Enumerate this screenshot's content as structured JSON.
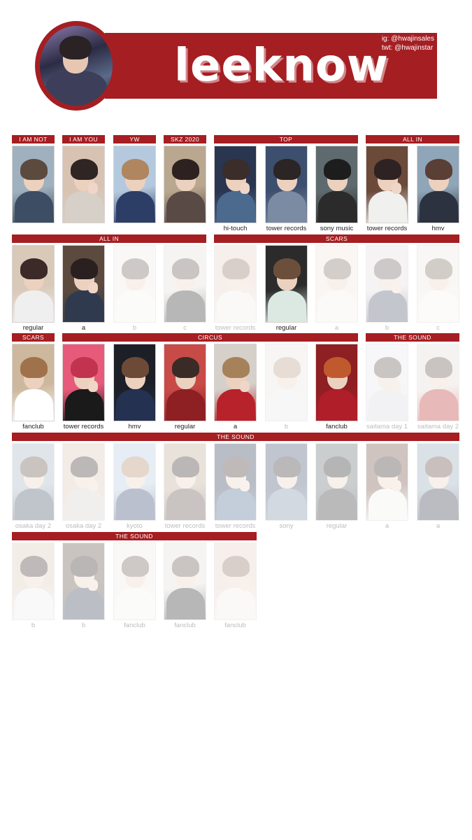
{
  "header": {
    "title": "leeknow",
    "social_ig": "ig: @hwajinsales",
    "social_twt": "twt: @hwajinstar",
    "accent_color": "#a51e22"
  },
  "sections": [
    {
      "label": "I AM NOT"
    },
    {
      "label": "I AM YOU"
    },
    {
      "label": "YW"
    },
    {
      "label": "SKZ 2020"
    },
    {
      "label": "TOP"
    },
    {
      "label": "ALL IN"
    },
    {
      "label": "ALL IN"
    },
    {
      "label": "SCARS"
    },
    {
      "label": "SCARS"
    },
    {
      "label": "CIRCUS"
    },
    {
      "label": "THE SOUND"
    },
    {
      "label": "THE SOUND"
    },
    {
      "label": "THE SOUND"
    }
  ],
  "cards": [
    {
      "caption": "",
      "owned": true
    },
    {
      "caption": "",
      "owned": true
    },
    {
      "caption": "",
      "owned": true
    },
    {
      "caption": "",
      "owned": true
    },
    {
      "caption": "hi-touch",
      "owned": true
    },
    {
      "caption": "tower records",
      "owned": true
    },
    {
      "caption": "sony music",
      "owned": true
    },
    {
      "caption": "tower records",
      "owned": true
    },
    {
      "caption": "hmv",
      "owned": true
    },
    {
      "caption": "regular",
      "owned": true
    },
    {
      "caption": "a",
      "owned": true
    },
    {
      "caption": "b",
      "owned": false
    },
    {
      "caption": "c",
      "owned": false
    },
    {
      "caption": "tower records",
      "owned": false
    },
    {
      "caption": "regular",
      "owned": true
    },
    {
      "caption": "a",
      "owned": false
    },
    {
      "caption": "b",
      "owned": false
    },
    {
      "caption": "c",
      "owned": false
    },
    {
      "caption": "fanclub",
      "owned": true
    },
    {
      "caption": "tower records",
      "owned": true
    },
    {
      "caption": "hmv",
      "owned": true
    },
    {
      "caption": "regular",
      "owned": true
    },
    {
      "caption": "a",
      "owned": true
    },
    {
      "caption": "b",
      "owned": false
    },
    {
      "caption": "fanclub",
      "owned": true
    },
    {
      "caption": "saitama day 1",
      "owned": false
    },
    {
      "caption": "saitama day 2",
      "owned": false
    },
    {
      "caption": "osaka day 2",
      "owned": false
    },
    {
      "caption": "osaka day 2",
      "owned": false
    },
    {
      "caption": "kyoto",
      "owned": false
    },
    {
      "caption": "tower records",
      "owned": false
    },
    {
      "caption": "tower records",
      "owned": false
    },
    {
      "caption": "sony",
      "owned": false
    },
    {
      "caption": "regular",
      "owned": false
    },
    {
      "caption": "a",
      "owned": false
    },
    {
      "caption": "a",
      "owned": false
    },
    {
      "caption": "b",
      "owned": false
    },
    {
      "caption": "b",
      "owned": false
    },
    {
      "caption": "fanclub",
      "owned": false
    },
    {
      "caption": "fanclub",
      "owned": false
    },
    {
      "caption": "fanclub",
      "owned": false
    }
  ]
}
